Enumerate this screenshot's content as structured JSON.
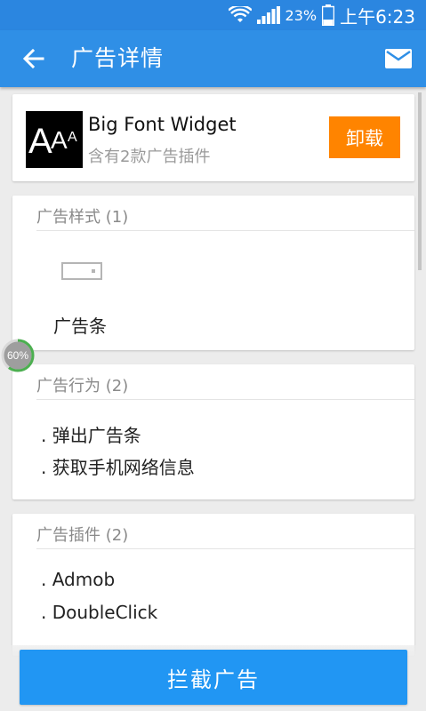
{
  "status_bar": {
    "battery_percent": "23%",
    "time": "上午6:23",
    "icons": [
      "wifi-icon",
      "signal-icon",
      "battery-icon"
    ]
  },
  "app_bar": {
    "title": "广告详情",
    "back_icon": "arrow-left-icon",
    "mail_icon": "mail-icon"
  },
  "app_info": {
    "icon_glyphs": [
      "A",
      "A",
      "A"
    ],
    "name": "Big Font Widget",
    "subtitle": "含有2款广告插件",
    "uninstall_label": "卸载"
  },
  "ad_styles": {
    "title": "广告样式 (1)",
    "items": [
      {
        "icon": "banner-icon",
        "label": "广告条"
      }
    ]
  },
  "ad_behaviors": {
    "title": "广告行为 (2)",
    "items": [
      ". 弹出广告条",
      ". 获取手机网络信息"
    ]
  },
  "ad_plugins": {
    "title": "广告插件 (2)",
    "items": [
      ". Admob",
      ". DoubleClick"
    ]
  },
  "floating_progress": {
    "label": "60%",
    "fraction": 0.6
  },
  "footer": {
    "block_label": "拦截广告"
  },
  "colors": {
    "status_bar": "#2b86e0",
    "app_bar": "#2f8fe6",
    "uninstall": "#ff8400",
    "block_button": "#2196f3",
    "progress": "#4caf50"
  }
}
